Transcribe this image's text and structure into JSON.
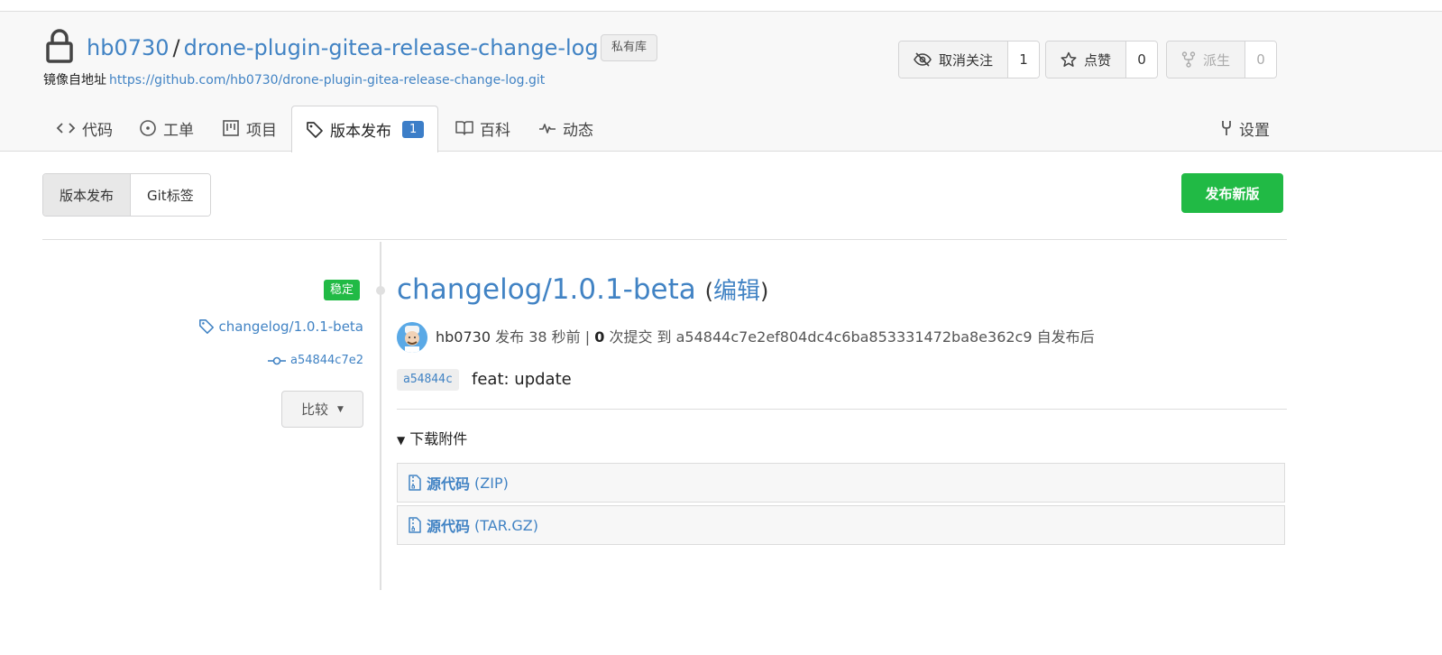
{
  "repo": {
    "owner": "hb0730",
    "separator": "/",
    "name": "drone-plugin-gitea-release-change-log",
    "private_badge": "私有库",
    "mirror_label": "镜像自地址",
    "mirror_url": "https://github.com/hb0730/drone-plugin-gitea-release-change-log.git"
  },
  "actions": {
    "watch": {
      "label": "取消关注",
      "count": "1"
    },
    "star": {
      "label": "点赞",
      "count": "0"
    },
    "fork": {
      "label": "派生",
      "count": "0"
    }
  },
  "tabs": [
    {
      "label": "代码",
      "icon": "code-icon"
    },
    {
      "label": "工单",
      "icon": "issue-icon"
    },
    {
      "label": "项目",
      "icon": "project-icon"
    },
    {
      "label": "版本发布",
      "icon": "tag-icon",
      "count": "1",
      "active": true
    },
    {
      "label": "百科",
      "icon": "book-icon"
    },
    {
      "label": "动态",
      "icon": "pulse-icon"
    }
  ],
  "settings_tab": {
    "label": "设置",
    "icon": "tools-icon"
  },
  "subnav": {
    "releases": "版本发布",
    "tags": "Git标签"
  },
  "new_release_button": "发布新版",
  "release": {
    "stable_label": "稳定",
    "tag": "changelog/1.0.1-beta",
    "commit_short": "a54844c7e2",
    "compare_label": "比较",
    "title": "changelog/1.0.1-beta",
    "edit_open": "(",
    "edit_label": "编辑",
    "edit_close": ")",
    "author": "hb0730",
    "published_text": "发布 38 秒前 |",
    "commits_count": "0",
    "commits_text": "次提交 到 a54844c7e2ef804dc4c6ba853331472ba8e362c9 自发布后",
    "commit_sha": "a54844c",
    "commit_message": "feat: update",
    "downloads_label": "下载附件",
    "assets": [
      {
        "name": "源代码",
        "type": "(ZIP)"
      },
      {
        "name": "源代码",
        "type": "(TAR.GZ)"
      }
    ]
  },
  "colors": {
    "link": "#4183c4",
    "green": "#21ba45",
    "badge_blue": "#3c7ec8"
  }
}
